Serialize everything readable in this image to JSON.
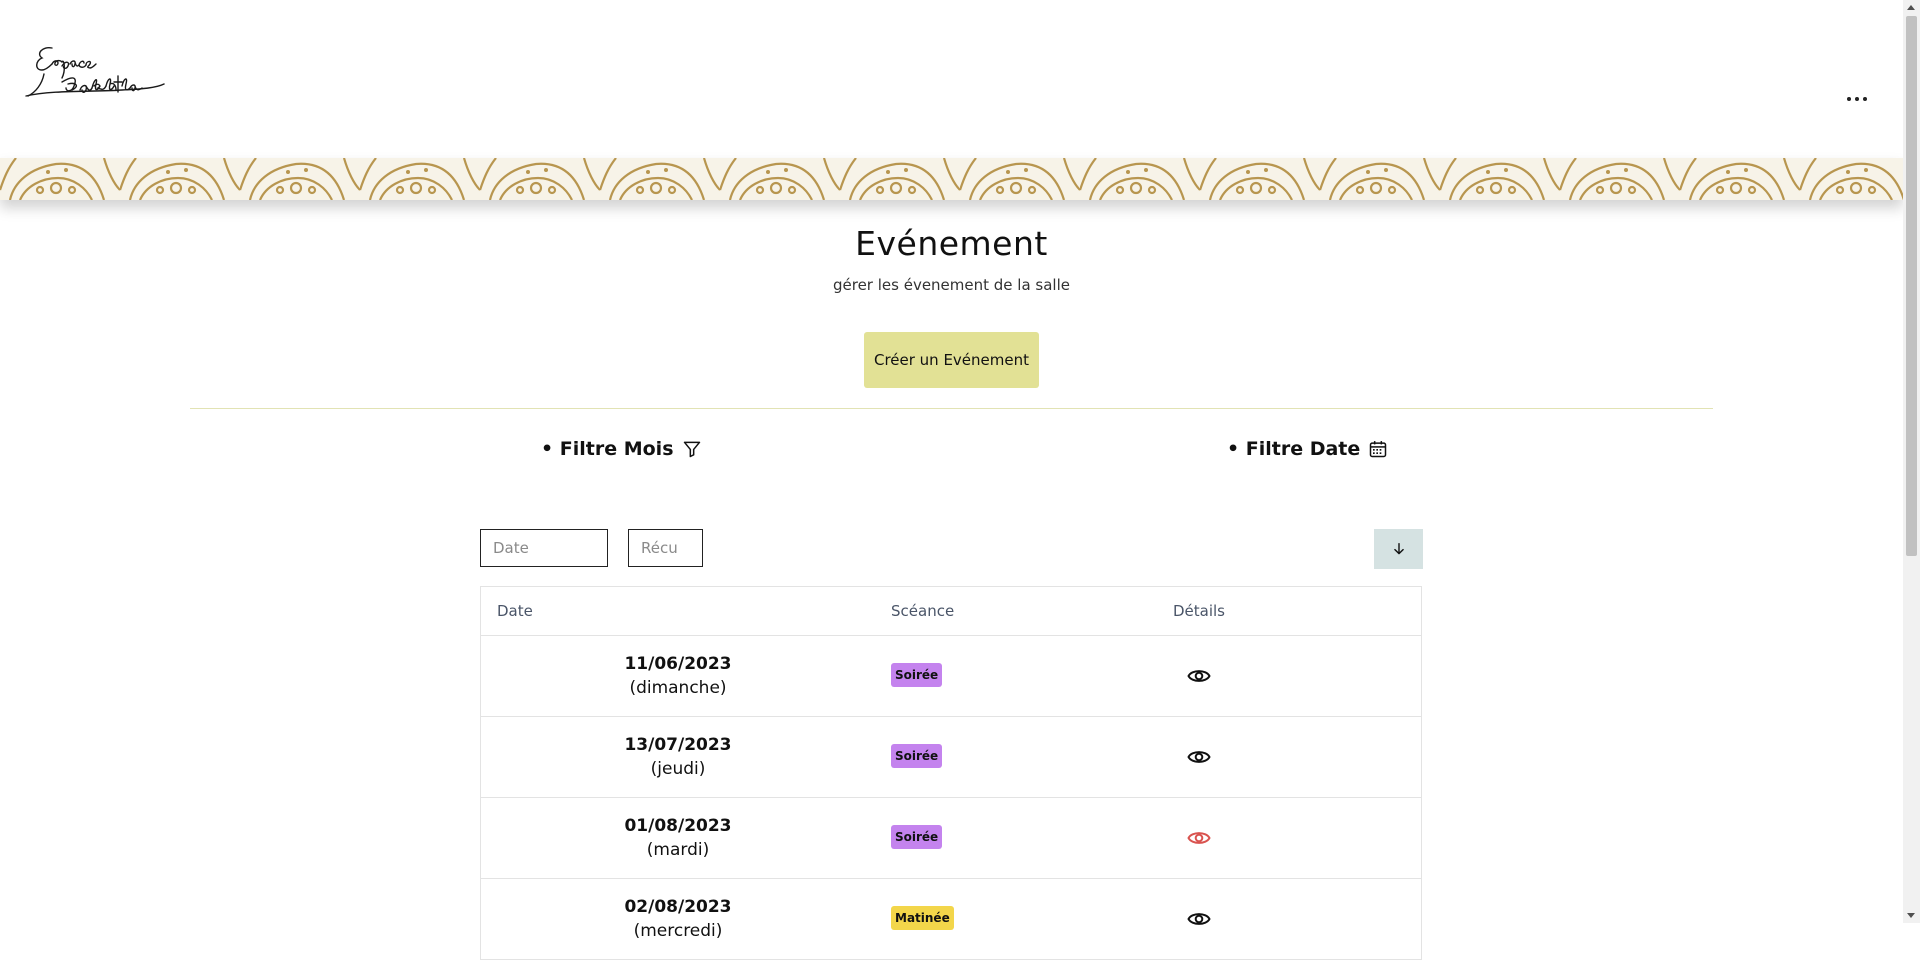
{
  "brand": {
    "logo_text": "Espace Bakhta"
  },
  "header": {
    "menu_icon": "more-horizontal-icon"
  },
  "page": {
    "title": "Evénement",
    "subtitle": "gérer les évenement de la salle",
    "create_button": "Créer un Evénement"
  },
  "filters": {
    "month_label": "• Filtre Mois",
    "month_icon": "filter-icon",
    "date_label": "• Filtre Date",
    "date_icon": "calendar-icon"
  },
  "search": {
    "date_placeholder": "Date",
    "recu_placeholder": "Récu",
    "sort_icon": "arrow-down-icon"
  },
  "table": {
    "headers": {
      "date": "Date",
      "seance": "Scéance",
      "details": "Détails"
    },
    "rows": [
      {
        "date": "11/06/2023",
        "day": "(dimanche)",
        "seance": "Soirée",
        "seance_type": "soiree",
        "eye_color": "#111111"
      },
      {
        "date": "13/07/2023",
        "day": "(jeudi)",
        "seance": "Soirée",
        "seance_type": "soiree",
        "eye_color": "#111111"
      },
      {
        "date": "01/08/2023",
        "day": "(mardi)",
        "seance": "Soirée",
        "seance_type": "soiree",
        "eye_color": "#d9534f"
      },
      {
        "date": "02/08/2023",
        "day": "(mercredi)",
        "seance": "Matinée",
        "seance_type": "matinee",
        "eye_color": "#111111"
      }
    ]
  },
  "colors": {
    "create_button_bg": "#e2e195",
    "sort_button_bg": "#d5e2e2",
    "badge_soiree": "#c483ee",
    "badge_matinee": "#f3d64a",
    "banner_gold": "#b8964f"
  }
}
